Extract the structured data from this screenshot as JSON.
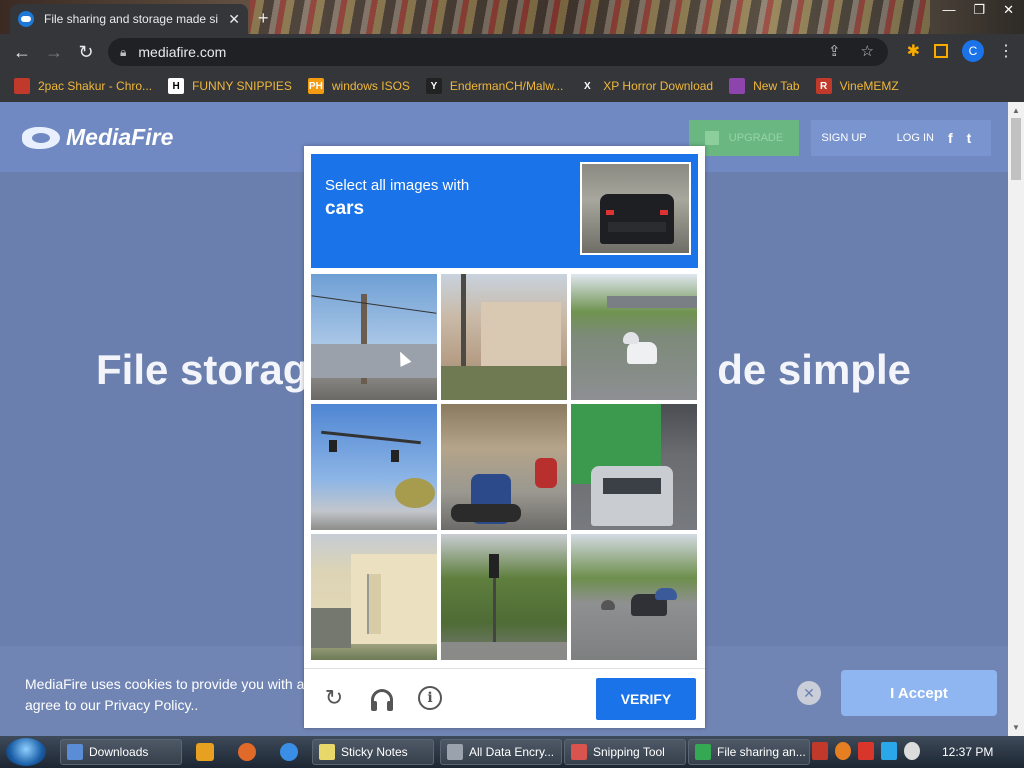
{
  "browser": {
    "tab_title": "File sharing and storage made si",
    "tab_close": "✕",
    "new_tab": "+",
    "url": "mediafire.com",
    "profile_initial": "C",
    "bookmarks": [
      {
        "label": "2pac Shakur - Chro...",
        "icon_color": "#c0392b",
        "icon_char": ""
      },
      {
        "label": "FUNNY SNIPPIES",
        "icon_color": "#ffffff",
        "icon_char": "H"
      },
      {
        "label": "windows ISOS",
        "icon_color": "#f39c12",
        "icon_char": "PH"
      },
      {
        "label": "EndermanCH/Malw...",
        "icon_color": "#222222",
        "icon_char": "Y"
      },
      {
        "label": "XP Horror Download",
        "icon_color": "#35363a",
        "icon_char": "X"
      },
      {
        "label": "New Tab",
        "icon_color": "#8e44ad",
        "icon_char": ""
      },
      {
        "label": "VineMEMZ",
        "icon_color": "#c0392b",
        "icon_char": "R"
      }
    ]
  },
  "site": {
    "logo_text": "MediaFire",
    "upgrade_label": "UPGRADE",
    "signup_label": "SIGN UP",
    "login_label": "LOG IN",
    "facebook_glyph": "f",
    "twitter_glyph": "t",
    "hero_left": "File storag",
    "hero_right": "de simple",
    "cookie_text": "MediaFire uses cookies to provide you with a p agree to our Privacy Policy..",
    "cookie_close": "✕",
    "accept_label": "I Accept"
  },
  "captcha": {
    "prompt_line1": "Select all images with",
    "prompt_target": "cars",
    "verify_label": "VERIFY",
    "reload_glyph": "↻",
    "info_glyph": "i",
    "tiles": [
      "tile-tree-wires",
      "tile-building-traffic-light",
      "tile-road-cars",
      "tile-traffic-signal-sky",
      "tile-motorcycles",
      "tile-truck-car",
      "tile-house",
      "tile-street-trees",
      "tile-road-vehicles"
    ]
  },
  "taskbar": {
    "buttons": [
      {
        "label": "Downloads",
        "icon_color": "#5b8dd6"
      },
      {
        "label": "Sticky Notes",
        "icon_color": "#e8d86a"
      },
      {
        "label": "All Data Encry...",
        "icon_color": "#9aa3ad"
      },
      {
        "label": "Snipping Tool",
        "icon_color": "#d9534f"
      },
      {
        "label": "File sharing an...",
        "icon_color": "#34a853"
      }
    ],
    "clock": "12:37 PM"
  }
}
